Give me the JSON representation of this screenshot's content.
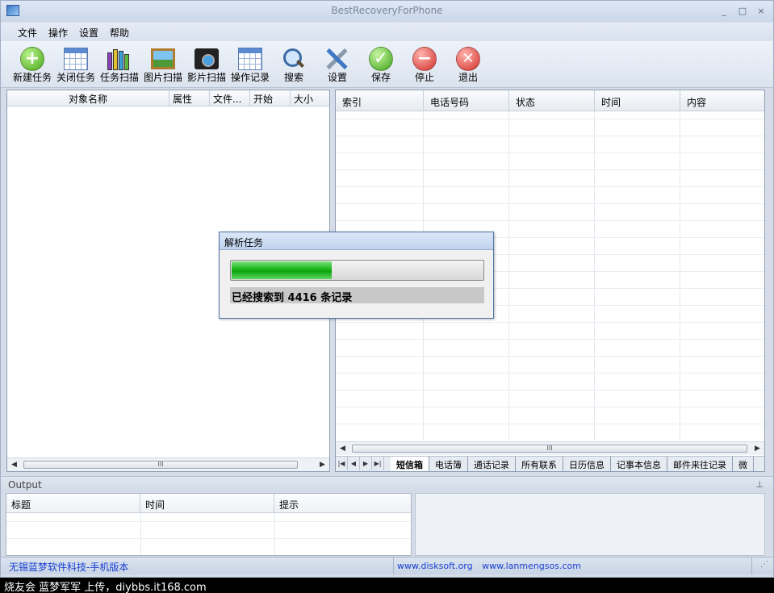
{
  "window": {
    "title": "BestRecoveryForPhone"
  },
  "window_buttons": [
    "_",
    "□",
    "×"
  ],
  "menu": [
    "文件",
    "操作",
    "设置",
    "帮助"
  ],
  "toolbar": [
    {
      "label": "新建任务",
      "icon": "add-icon",
      "color": "#5cbf2a"
    },
    {
      "label": "关闭任务",
      "icon": "calendar-icon"
    },
    {
      "label": "任务扫描",
      "icon": "books-icon"
    },
    {
      "label": "图片扫描",
      "icon": "picture-icon"
    },
    {
      "label": "影片扫描",
      "icon": "film-icon"
    },
    {
      "label": "操作记录",
      "icon": "calendar-icon"
    },
    {
      "label": "搜索",
      "icon": "magnifier-icon"
    },
    {
      "label": "设置",
      "icon": "tools-icon"
    },
    {
      "label": "保存",
      "icon": "check-icon",
      "color": "#4cb82a"
    },
    {
      "label": "停止",
      "icon": "minus-icon",
      "color": "#e0443c"
    },
    {
      "label": "退出",
      "icon": "close-icon",
      "color": "#e0443c"
    }
  ],
  "left_table": {
    "columns": [
      "对象名称",
      "属性",
      "文件...",
      "开始",
      "大小"
    ]
  },
  "right_table": {
    "columns": [
      "索引",
      "电话号码",
      "状态",
      "时间",
      "内容"
    ],
    "tabs": [
      "短信箱",
      "电话簿",
      "通话记录",
      "所有联系",
      "日历信息",
      "记事本信息",
      "邮件来往记录",
      "微"
    ],
    "active_tab": "短信箱"
  },
  "scroll_thumb": "III",
  "output": {
    "title": "Output",
    "pin": "⊥",
    "columns": [
      "标题",
      "时间",
      "提示"
    ]
  },
  "status": {
    "left": "无锡蓝梦软件科技-手机版本",
    "link1": "www.disksoft.org",
    "link2": "www.lanmengsos.com",
    "grip": "⋰"
  },
  "dialog": {
    "title": "解析任务",
    "message": "已经搜索到 4416 条记录",
    "progress_fraction": 0.4
  },
  "caption": "烧友会 蓝梦军军 上传，diybbs.it168.com"
}
